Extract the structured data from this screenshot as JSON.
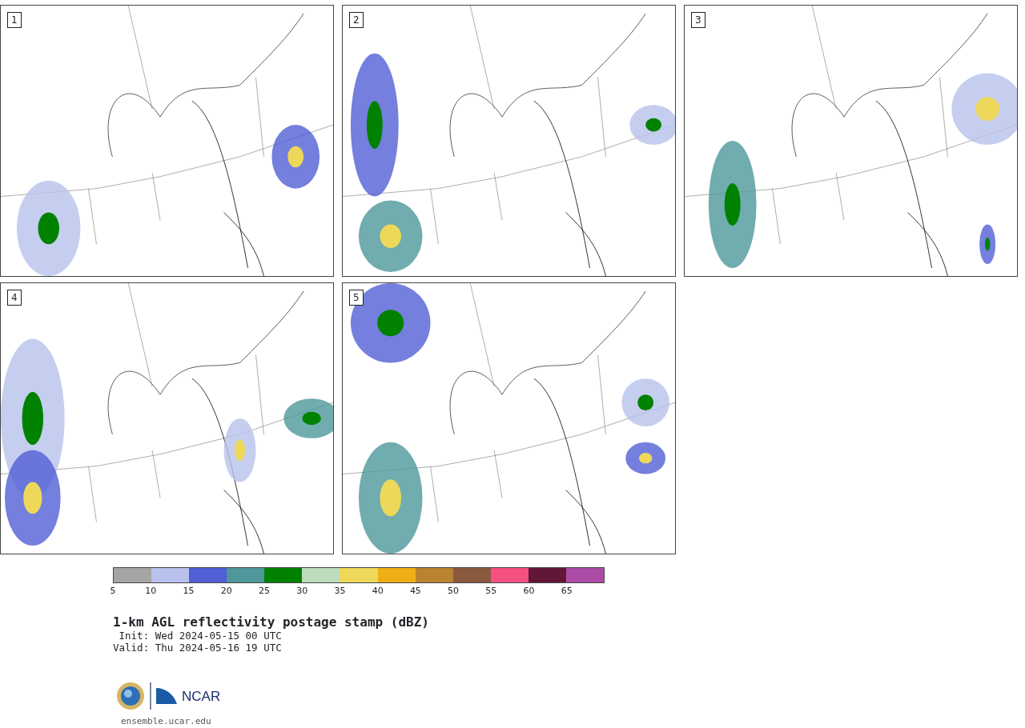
{
  "panels": [
    {
      "label": "1"
    },
    {
      "label": "2"
    },
    {
      "label": "3"
    },
    {
      "label": "4"
    },
    {
      "label": "5"
    }
  ],
  "colorbar": {
    "segments": [
      {
        "color": "#a5a5a5"
      },
      {
        "color": "#b8c2ec"
      },
      {
        "color": "#515fd6"
      },
      {
        "color": "#4e979b"
      },
      {
        "color": "#008200"
      },
      {
        "color": "#bedcbd"
      },
      {
        "color": "#eed85a"
      },
      {
        "color": "#efae16"
      },
      {
        "color": "#b98330"
      },
      {
        "color": "#8a5a3f"
      },
      {
        "color": "#f45080"
      },
      {
        "color": "#621638"
      },
      {
        "color": "#ad4ca6"
      }
    ],
    "ticks": [
      "5",
      "10",
      "15",
      "20",
      "25",
      "30",
      "35",
      "40",
      "45",
      "50",
      "55",
      "60",
      "65"
    ]
  },
  "title": "1-km AGL reflectivity postage stamp (dBZ)",
  "init": " Init: Wed 2024-05-15 00 UTC",
  "valid": "Valid: Thu 2024-05-16 19 UTC",
  "logo": {
    "text": "NCAR"
  },
  "footer": "ensemble.ucar.edu"
}
